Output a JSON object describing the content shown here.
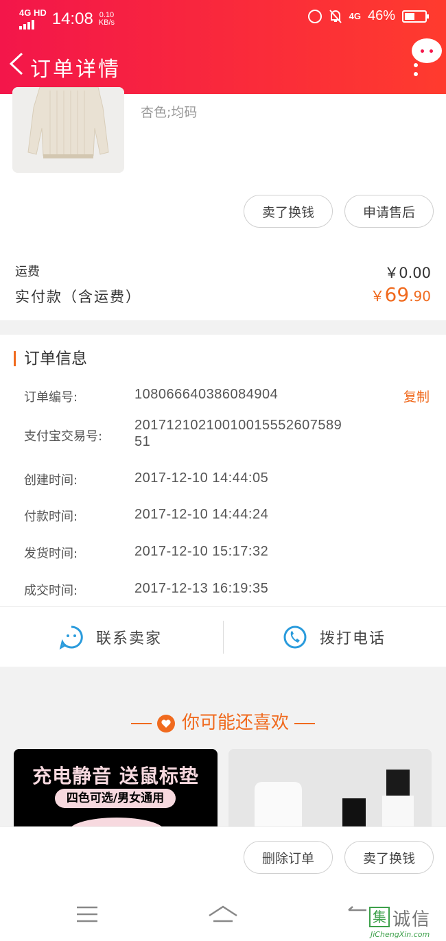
{
  "status_bar": {
    "network": "4G HD",
    "time": "14:08",
    "speed": "0.10",
    "speed_unit": "KB/s",
    "network_right": "4G",
    "battery": "46%"
  },
  "header": {
    "title": "订单详情"
  },
  "product": {
    "spec": "杏色;均码",
    "buttons": [
      "卖了换钱",
      "申请售后"
    ]
  },
  "fees": {
    "shipping_label": "运费",
    "shipping_value": "￥0.00",
    "paid_label": "实付款（含运费）",
    "paid_currency": "￥",
    "paid_int": "69",
    "paid_dec": ".90"
  },
  "order_info": {
    "title": "订单信息",
    "copy_label": "复制",
    "rows": [
      {
        "label": "订单编号:",
        "value": "1080666403860849​04"
      },
      {
        "label": "支付宝交易号:",
        "value": "20171210210010015552607589",
        "value2": "51"
      },
      {
        "label": "创建时间:",
        "value": "2017-12-10 14:44:05"
      },
      {
        "label": "付款时间:",
        "value": "2017-12-10 14:44:24"
      },
      {
        "label": "发货时间:",
        "value": "2017-12-10 15:17:32"
      },
      {
        "label": "成交时间:",
        "value": "2017-12-13 16:19:35"
      }
    ]
  },
  "contact": {
    "seller": "联系卖家",
    "phone": "拨打电话"
  },
  "recommend": {
    "title": "你可能还喜欢",
    "ad_line1": "充电静音 送鼠标垫",
    "ad_line2": "四色可选/男女通用"
  },
  "bottom_bar": {
    "delete": "删除订单",
    "sell": "卖了换钱"
  },
  "watermark": {
    "brand": "集诚信",
    "domain": "JiChengXin.com"
  },
  "colors": {
    "header_start": "#f3164a",
    "header_end": "#ff3b2e",
    "accent": "#f06a1e",
    "contact_icon": "#2a9bdc"
  }
}
